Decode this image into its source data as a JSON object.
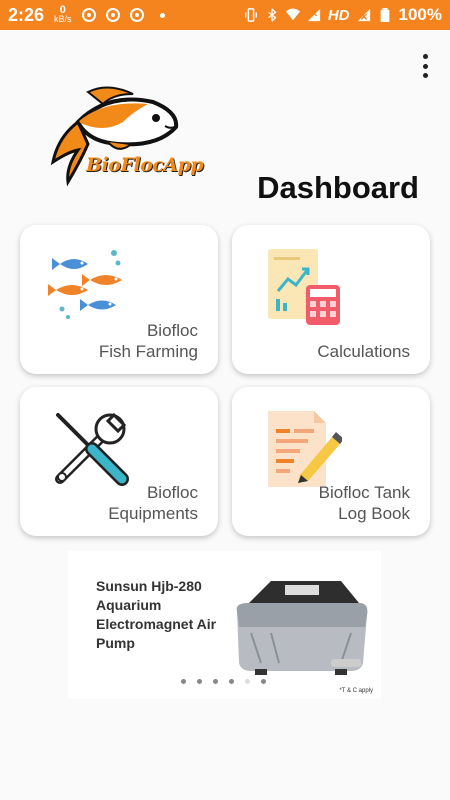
{
  "status_bar": {
    "time": "2:26",
    "net_speed_value": "0",
    "net_speed_unit": "kB/s",
    "network_type": "HD",
    "battery": "100%"
  },
  "app": {
    "logo_text": "BioFlocApp",
    "title": "Dashboard"
  },
  "cards": [
    {
      "line1": "Biofloc",
      "line2": "Fish Farming",
      "icon": "fish-icon"
    },
    {
      "line1": "",
      "line2": "Calculations",
      "icon": "calculator-chart-icon"
    },
    {
      "line1": "Biofloc",
      "line2": "Equipments",
      "icon": "tools-icon"
    },
    {
      "line1": "Biofloc Tank",
      "line2": "Log Book",
      "icon": "logbook-icon"
    }
  ],
  "banner": {
    "title": "Sunsun Hjb-280 Aquarium Electromagnet Air Pump",
    "fine_print": "*T & C apply",
    "slides_total": 6,
    "active_slide": 4
  },
  "colors": {
    "status_bar": "#f5841f",
    "accent_orange": "#f28a1a"
  }
}
